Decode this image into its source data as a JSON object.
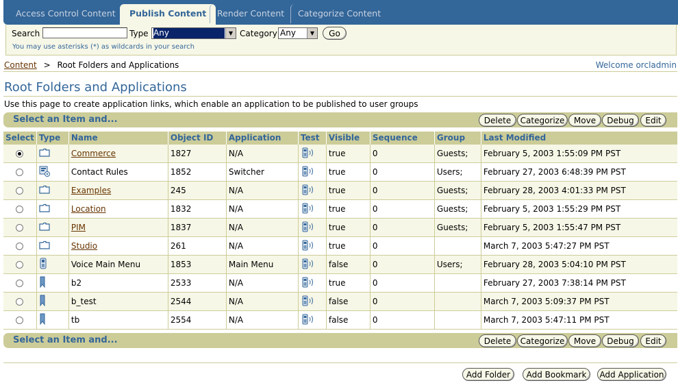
{
  "tabs": [
    {
      "label": "Access Control Content",
      "active": false
    },
    {
      "label": "Publish Content",
      "active": true
    },
    {
      "label": "Render Content",
      "active": false
    },
    {
      "label": "Categorize Content",
      "active": false
    }
  ],
  "search": {
    "search_label": "Search",
    "search_value": "",
    "type_label": "Type",
    "type_value": "Any",
    "category_label": "Category",
    "category_value": "Any",
    "go_label": "Go",
    "hint": "You may use asterisks (*) as wildcards in your search"
  },
  "breadcrumb": {
    "link": "Content",
    "separator": ">",
    "current": "Root Folders and Applications"
  },
  "welcome": "Welcome orcladmin",
  "page_title": "Root Folders and Applications",
  "description": "Use this page to create application links, which enable an application to be published to user groups",
  "control_bar": {
    "label": "Select an Item and...",
    "buttons": [
      "Delete",
      "Categorize",
      "Move",
      "Debug",
      "Edit"
    ]
  },
  "table": {
    "headers": [
      "Select",
      "Type",
      "Name",
      "Object ID",
      "Application",
      "Test",
      "Visible",
      "Sequence",
      "Group",
      "Last Modified"
    ],
    "rows": [
      {
        "selected": true,
        "type_icon": "folder-icon",
        "name": "Commerce",
        "link": true,
        "object_id": "1827",
        "application": "N/A",
        "visible": "true",
        "sequence": "0",
        "group": "Guests;",
        "modified": "February 5, 2003 1:55:09 PM PST"
      },
      {
        "selected": false,
        "type_icon": "app-link-icon",
        "name": "Contact Rules",
        "link": false,
        "object_id": "1852",
        "application": "Switcher",
        "visible": "true",
        "sequence": "0",
        "group": "Users;",
        "modified": "February 27, 2003 6:48:39 PM PST"
      },
      {
        "selected": false,
        "type_icon": "folder-icon",
        "name": "Examples",
        "link": true,
        "object_id": "245",
        "application": "N/A",
        "visible": "true",
        "sequence": "0",
        "group": "Guests;",
        "modified": "February 28, 2003 4:01:33 PM PST"
      },
      {
        "selected": false,
        "type_icon": "folder-icon",
        "name": "Location",
        "link": true,
        "object_id": "1832",
        "application": "N/A",
        "visible": "true",
        "sequence": "0",
        "group": "Guests;",
        "modified": "February 5, 2003 1:55:29 PM PST"
      },
      {
        "selected": false,
        "type_icon": "folder-icon",
        "name": "PIM",
        "link": true,
        "object_id": "1837",
        "application": "N/A",
        "visible": "true",
        "sequence": "0",
        "group": "Guests;",
        "modified": "February 5, 2003 1:55:47 PM PST"
      },
      {
        "selected": false,
        "type_icon": "folder-icon",
        "name": "Studio",
        "link": true,
        "object_id": "261",
        "application": "N/A",
        "visible": "true",
        "sequence": "0",
        "group": "",
        "modified": "March 7, 2003 5:47:27 PM PST"
      },
      {
        "selected": false,
        "type_icon": "phone-app-icon",
        "name": "Voice Main Menu",
        "link": false,
        "object_id": "1853",
        "application": "Main Menu",
        "visible": "false",
        "sequence": "0",
        "group": "Users;",
        "modified": "February 28, 2003 5:04:10 PM PST"
      },
      {
        "selected": false,
        "type_icon": "bookmark-icon",
        "name": "b2",
        "link": false,
        "object_id": "2533",
        "application": "N/A",
        "visible": "true",
        "sequence": "0",
        "group": "",
        "modified": "February 27, 2003 7:38:14 PM PST"
      },
      {
        "selected": false,
        "type_icon": "bookmark-icon",
        "name": "b_test",
        "link": false,
        "object_id": "2544",
        "application": "N/A",
        "visible": "false",
        "sequence": "0",
        "group": "",
        "modified": "March 7, 2003 5:09:37 PM PST"
      },
      {
        "selected": false,
        "type_icon": "bookmark-icon",
        "name": "tb",
        "link": false,
        "object_id": "2554",
        "application": "N/A",
        "visible": "false",
        "sequence": "0",
        "group": "",
        "modified": "March 7, 2003 5:47:11 PM PST"
      }
    ],
    "test_icon": "test-device-icon"
  },
  "bottom_buttons": [
    "Add Folder",
    "Add Bookmark",
    "Add Application"
  ],
  "colors": {
    "brand_blue": "#336699",
    "tan": "#cccc99",
    "cream": "#f7f7e7",
    "link_brown": "#663300"
  }
}
